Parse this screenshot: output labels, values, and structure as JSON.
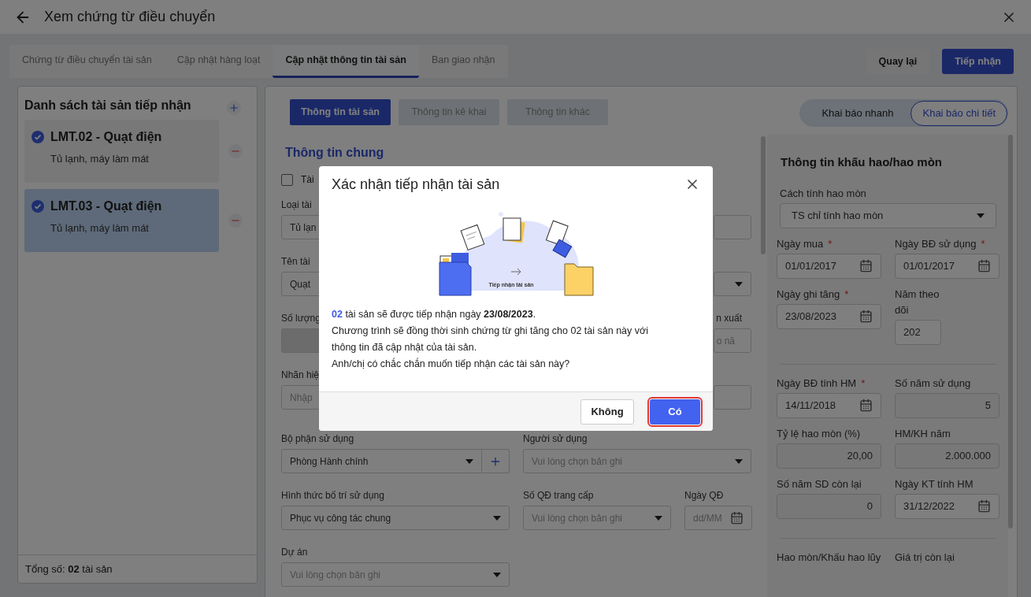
{
  "window": {
    "title": "Xem chứng từ điều chuyển"
  },
  "tabs": [
    {
      "label": "Chứng từ điều chuyển tài sản",
      "selected": false
    },
    {
      "label": "Cập nhật hàng loạt",
      "selected": false
    },
    {
      "label": "Cập nhật thông tin tài sản",
      "selected": true
    },
    {
      "label": "Ban giao nhận",
      "selected": false
    }
  ],
  "actions": [
    {
      "label": "Quay lại",
      "kind": "secondary"
    },
    {
      "label": "Tiếp nhận",
      "kind": "primary"
    }
  ],
  "asset_list": {
    "title": "Danh sách tài sản tiếp nhận",
    "items": [
      {
        "name": "LMT.02 - Quạt điện",
        "category": "Tủ lạnh, máy làm mát",
        "checked": true,
        "selected": false
      },
      {
        "name": "LMT.03 - Quạt điện",
        "category": "Tủ lạnh, máy làm mát",
        "checked": true,
        "selected": true
      }
    ],
    "total": "Tổng số: **02** tài sản"
  },
  "detail_tabs": [
    {
      "label": "Thông tin tài sản",
      "selected": true
    },
    {
      "label": "Thông tin kê khai",
      "selected": false
    },
    {
      "label": "Thông tin khác",
      "selected": false
    }
  ],
  "mode_toggle": [
    {
      "label": "Khai báo nhanh",
      "selected": false
    },
    {
      "label": "Khai báo chi tiết",
      "selected": true
    }
  ],
  "general": {
    "title": "Thông tin chung",
    "checkbox": {
      "label": "Tài",
      "checked": false
    },
    "rows": [
      [
        {
          "kind": "text",
          "label": "Loại tài",
          "value": "Tủ lạn"
        },
        {
          "kind": "text"
        }
      ],
      [
        {
          "kind": "text",
          "label": "Tên tài",
          "value": "Quạt"
        },
        {
          "kind": "select"
        }
      ],
      [
        {
          "kind": "text",
          "label": "Số lượng",
          "disabled": true
        },
        {
          "kind": "text",
          "label": "n xuất",
          "placeholder": "o nă"
        }
      ],
      [
        {
          "kind": "text",
          "label": "Nhãn hiệ",
          "placeholder": "Nhập"
        },
        {
          "kind": "text"
        }
      ],
      [
        {
          "kind": "select_add",
          "label": "Bộ phận sử dụng",
          "value": "Phòng Hành chính"
        },
        {
          "kind": "select",
          "label": "Người sử dụng",
          "placeholder": "Vui lòng chọn bản ghi"
        }
      ],
      [
        {
          "kind": "select",
          "label": "Hình thức bố trí sử dụng",
          "value": "Phục vụ công tác chung"
        },
        {
          "kind": "select",
          "label": "Số QĐ trang cấp",
          "placeholder": "Vui lòng chọn bản ghi"
        },
        {
          "kind": "date",
          "label": "Ngày QĐ",
          "placeholder": "dd/MM"
        }
      ],
      [
        {
          "kind": "select",
          "label": "Dự án",
          "placeholder": "Vui lòng chọn bản ghi"
        }
      ]
    ]
  },
  "depreciation": {
    "title": "Thông tin khấu hao/hao mòn",
    "required_mark": "*",
    "rows": [
      {
        "kind": "fields",
        "fields": [
          {
            "kind": "select",
            "label": "Cách tính hao mòn",
            "value": "TS chỉ tính hao mòn",
            "required": false
          }
        ]
      },
      {
        "kind": "fields",
        "fields": [
          {
            "kind": "date",
            "label": "Ngày mua",
            "value": "01/01/2017",
            "required": true
          },
          {
            "kind": "date",
            "label": "Ngày BĐ sử dụng",
            "value": "01/01/2017",
            "required": true
          }
        ]
      },
      {
        "kind": "fields",
        "fields": [
          {
            "kind": "date",
            "label": "Ngày ghi tăng",
            "value": "23/08/2023",
            "required": true
          },
          {
            "kind": "short",
            "label": "Năm theo dõi",
            "value": "202",
            "required": false
          }
        ]
      },
      {
        "kind": "divider"
      },
      {
        "kind": "fields",
        "fields": [
          {
            "kind": "date",
            "label": "Ngày BĐ tính HM",
            "value": "14/11/2018",
            "required": true
          },
          {
            "kind": "number",
            "label": "Số năm sử dụng",
            "value": "5",
            "required": false
          }
        ]
      },
      {
        "kind": "fields",
        "fields": [
          {
            "kind": "number",
            "label": "Tỷ lệ hao mòn (%)",
            "value": "20,00",
            "required": false
          },
          {
            "kind": "number",
            "label": "HM/KH năm",
            "value": "2.000.000",
            "required": false
          }
        ]
      },
      {
        "kind": "fields",
        "fields": [
          {
            "kind": "number",
            "label": "Số năm SD còn lại",
            "value": "0",
            "required": false
          },
          {
            "kind": "date",
            "label": "Ngày KT tính HM",
            "value": "31/12/2022",
            "required": false
          }
        ]
      },
      {
        "kind": "divider"
      },
      {
        "kind": "fields",
        "fields": [
          {
            "kind": "label",
            "label": "Hao mòn/Khấu hao lũy",
            "required": false
          },
          {
            "kind": "label",
            "label": "Giá trị còn lại",
            "required": false
          }
        ]
      }
    ]
  },
  "dialog": {
    "title": "Xác nhận tiếp nhận tài sản",
    "illustration_caption": "Tiếp nhận tài sản",
    "count": "02",
    "lead": " tài sản sẽ được tiếp nhận ngày **23/08/2023**.",
    "lines": [
      "Chương trình sẽ đồng thời sinh chứng từ ghi tăng cho 02 tài sản này với thông tin đã cập nhật của tài sản.",
      "Anh/chị có chắc chắn muốn tiếp nhận các tài sản này?"
    ],
    "buttons": [
      {
        "label": "Không",
        "kind": "secondary",
        "focused": false
      },
      {
        "label": "Có",
        "kind": "primary",
        "focused": true
      }
    ]
  }
}
